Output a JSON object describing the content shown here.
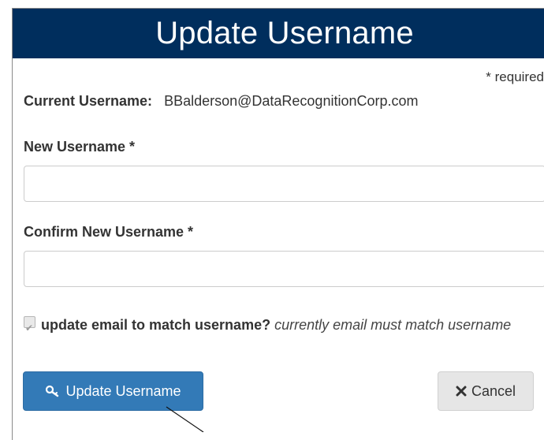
{
  "dialog": {
    "title": "Update Username",
    "required_note": "* required"
  },
  "current": {
    "label": "Current Username:",
    "value": "BBalderson@DataRecognitionCorp.com"
  },
  "new_username": {
    "label": "New Username *",
    "value": "",
    "placeholder": ""
  },
  "confirm_username": {
    "label": "Confirm New Username *",
    "value": "",
    "placeholder": ""
  },
  "update_email": {
    "checked": true,
    "label": "update email to match username?",
    "note": "currently email must match username"
  },
  "buttons": {
    "update_label": "Update Username",
    "update_icon": "key-icon",
    "cancel_label": "Cancel",
    "cancel_icon": "close-icon"
  },
  "colors": {
    "header_bg": "#002e5d",
    "primary_button": "#337ab7",
    "cancel_button": "#e6e6e6"
  }
}
